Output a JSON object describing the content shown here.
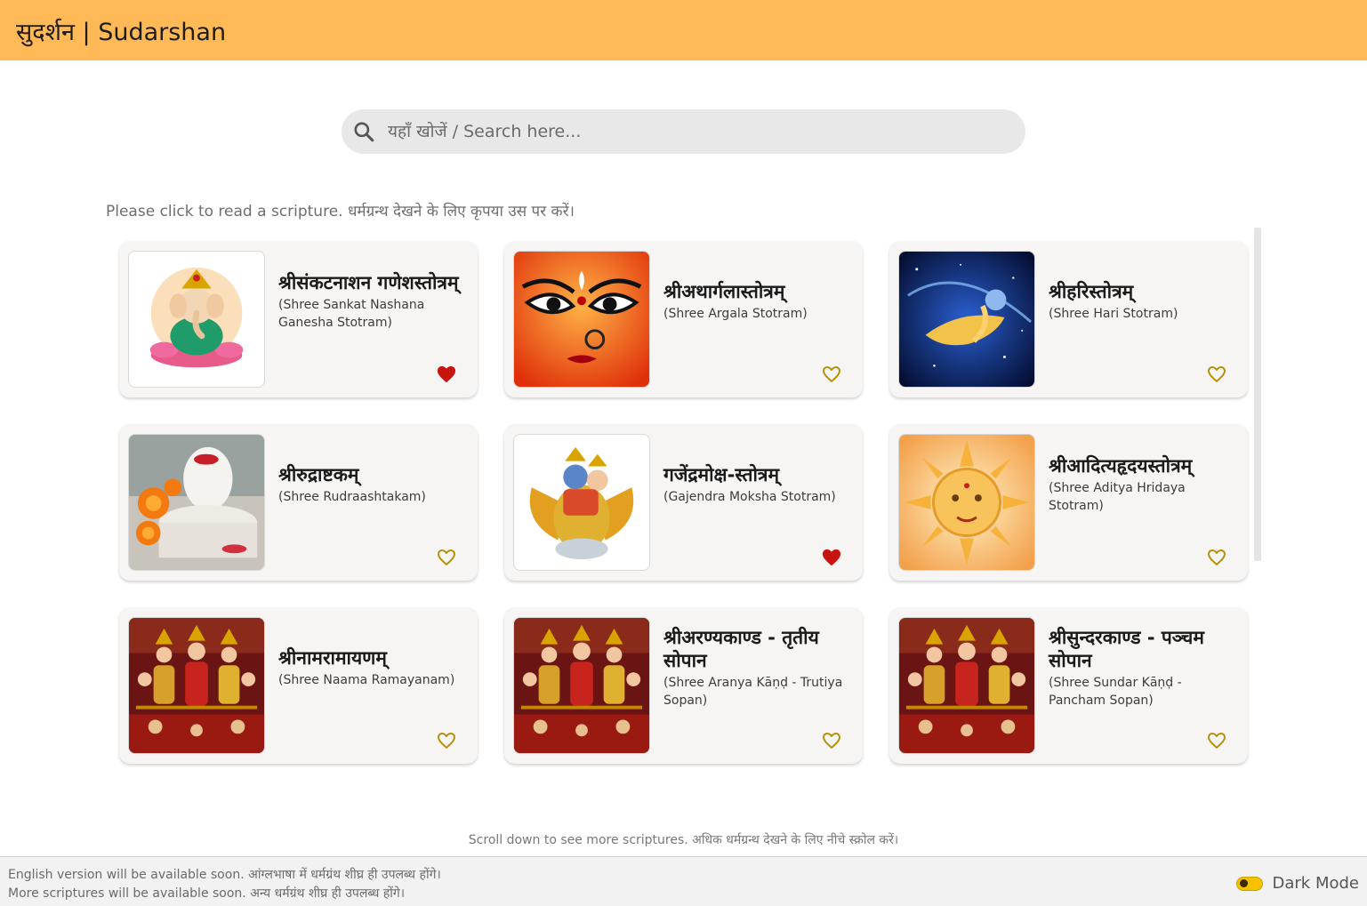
{
  "header": {
    "title": "सुदर्शन | Sudarshan",
    "bg_color": "#ffb957"
  },
  "search": {
    "placeholder": "यहाँ खोजें / Search here...",
    "icon": "search-icon"
  },
  "instruction": "Please click to read a scripture. धर्मग्रन्थ देखने के लिए कृपया उस पर करें।",
  "scriptures": [
    {
      "name_sa": "श्रीसंकटनाशन गणेशस्तोत्रम्",
      "name_en": "(Shree Sankat Nashana Ganesha Stotram)",
      "image": "ganesha-image",
      "favorite": true
    },
    {
      "name_sa": "श्रीअथार्गलास्तोत्रम्",
      "name_en": "(Shree Argala Stotram)",
      "image": "durga-face-image",
      "favorite": false
    },
    {
      "name_sa": "श्रीहरिस्तोत्रम्",
      "name_en": "(Shree Hari Stotram)",
      "image": "vishnu-cosmic-image",
      "favorite": false
    },
    {
      "name_sa": "श्रीरुद्राष्टकम्",
      "name_en": "(Shree Rudraashtakam)",
      "image": "shivling-image",
      "favorite": false
    },
    {
      "name_sa": "गजेंद्रमोक्ष-स्तोत्रम्",
      "name_en": "(Gajendra Moksha Stotram)",
      "image": "vishnu-garuda-image",
      "favorite": true
    },
    {
      "name_sa": "श्रीआदित्यहृदयस्तोत्रम्",
      "name_en": "(Shree Aditya Hridaya Stotram)",
      "image": "sun-god-image",
      "favorite": false
    },
    {
      "name_sa": "श्रीनामरामायणम्",
      "name_en": "(Shree Naama Ramayanam)",
      "image": "ram-darbar-image",
      "favorite": false
    },
    {
      "name_sa": "श्रीअरण्यकाण्ड - तृतीय सोपान",
      "name_en": "(Shree Aranya Kāṇḍ - Trutiya Sopan)",
      "image": "ram-darbar-image",
      "favorite": false
    },
    {
      "name_sa": "श्रीसुन्दरकाण्ड - पञ्चम सोपान",
      "name_en": "(Shree Sundar Kāṇḍ - Pancham Sopan)",
      "image": "ram-darbar-image",
      "favorite": false
    }
  ],
  "favorite_colors": {
    "filled": "#c8140f",
    "outline": "#b5920a"
  },
  "scroll_hint": "Scroll down to see more scriptures. अधिक धर्मग्रन्थ देखने के लिए नीचे स्क्रोल करें।",
  "footer": {
    "note_1": "English version will be available soon. आंग्लभाषा में धर्मग्रंथ शीघ्र ही उपलब्ध होंगे।",
    "note_2": "More scriptures will be available soon. अन्य धर्मग्रंथ शीघ्र ही उपलब्ध होंगे।",
    "dark_mode_label": "Dark Mode",
    "dark_mode_enabled": false
  }
}
